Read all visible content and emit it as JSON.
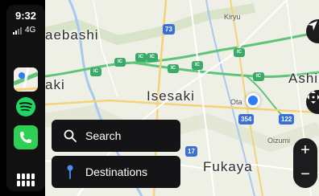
{
  "status": {
    "time": "9:32",
    "network": "4G"
  },
  "sidebar": {
    "apps": [
      {
        "name": "Maps",
        "icon": "maps-icon"
      },
      {
        "name": "Spotify",
        "icon": "spotify-icon"
      },
      {
        "name": "Phone",
        "icon": "phone-icon"
      }
    ],
    "home_icon": "app-grid-icon"
  },
  "map": {
    "places": {
      "maebashi": "aebashi",
      "aki": "aki",
      "isesaki": "Isesaki",
      "fukaya": "Fukaya",
      "ashi": "Ashi",
      "kiryu": "Kiryu",
      "ota": "Ota",
      "oizumi": "Oizumi"
    },
    "routes": {
      "r73": "73",
      "r354": "354",
      "r122": "122",
      "r17": "17"
    },
    "ic_label": "IC",
    "colors": {
      "land": "#eef0e6",
      "highway": "#5fc37a",
      "road": "#f5d27a",
      "location": "#2f7cf6",
      "water": "#a8c8f0"
    }
  },
  "controls": {
    "search_label": "Search",
    "destinations_label": "Destinations",
    "zoom_in": "+",
    "zoom_out": "−"
  }
}
